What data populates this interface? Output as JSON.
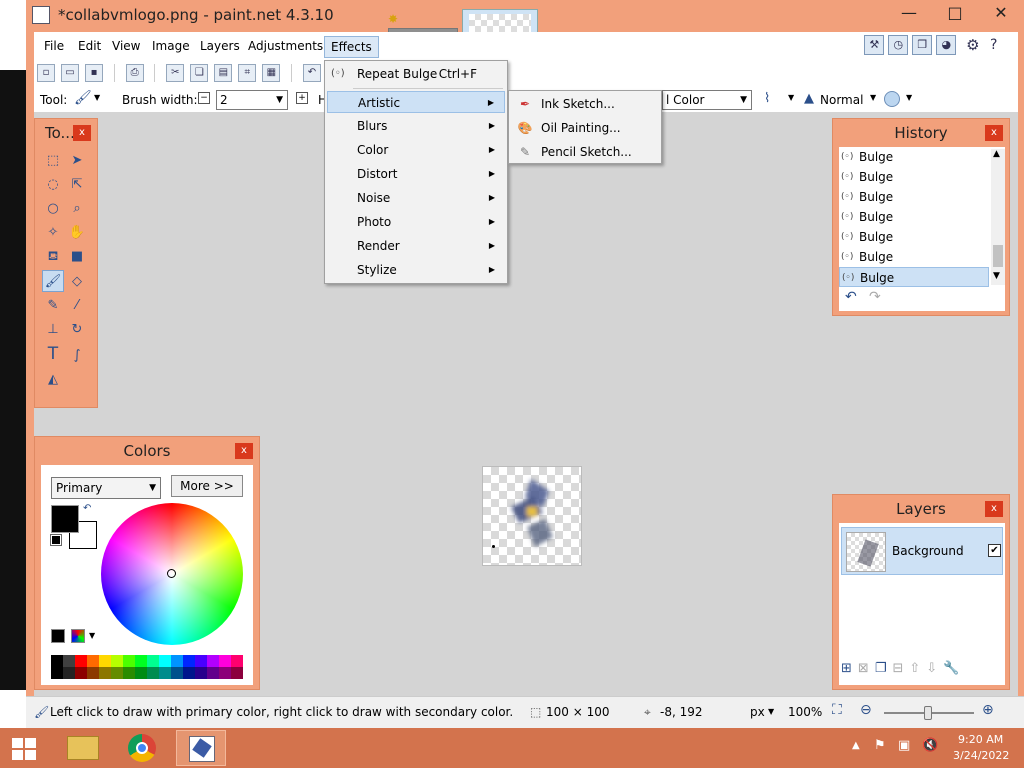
{
  "window": {
    "title": "*collabvmlogo.png - paint.net 4.3.10",
    "minimize": "—",
    "maximize": "□",
    "close": "✕"
  },
  "menubar": {
    "items": [
      "File",
      "Edit",
      "View",
      "Image",
      "Layers",
      "Adjustments",
      "Effects"
    ]
  },
  "toolbar": {
    "tool_label": "Tool:",
    "brush_width_label": "Brush width:",
    "brush_width_value": "2",
    "hardness_label": "H",
    "fill_label": "l Color",
    "blend_mode": "Normal"
  },
  "effects_menu": {
    "repeat": {
      "label": "Repeat Bulge",
      "shortcut": "Ctrl+F"
    },
    "items": [
      "Artistic",
      "Blurs",
      "Color",
      "Distort",
      "Noise",
      "Photo",
      "Render",
      "Stylize"
    ]
  },
  "artistic_submenu": {
    "items": [
      "Ink Sketch...",
      "Oil Painting...",
      "Pencil Sketch..."
    ]
  },
  "tools_panel": {
    "title": "To...",
    "close": "x"
  },
  "colors_panel": {
    "title": "Colors",
    "close": "x",
    "mode": "Primary",
    "more_button": "More >>",
    "palette": [
      "#000000",
      "#404040",
      "#ff0000",
      "#ff6a00",
      "#ffd800",
      "#b6ff00",
      "#4cff00",
      "#00ff21",
      "#00ff90",
      "#00ffff",
      "#0094ff",
      "#0026ff",
      "#4800ff",
      "#b200ff",
      "#ff00dc",
      "#ff006e"
    ]
  },
  "history_panel": {
    "title": "History",
    "close": "x",
    "items": [
      "Bulge",
      "Bulge",
      "Bulge",
      "Bulge",
      "Bulge",
      "Bulge",
      "Bulge"
    ]
  },
  "layers_panel": {
    "title": "Layers",
    "close": "x",
    "layer_name": "Background"
  },
  "statusbar": {
    "hint": "Left click to draw with primary color, right click to draw with secondary color.",
    "image_size": "100 × 100",
    "cursor_pos": "-8, 192",
    "units": "px",
    "zoom": "100%"
  },
  "taskbar": {
    "time": "9:20 AM",
    "date": "3/24/2022"
  },
  "colors": {
    "accent": "#f2a07b",
    "menu_highlight": "#cde1f5",
    "taskbar": "#d3734d"
  }
}
